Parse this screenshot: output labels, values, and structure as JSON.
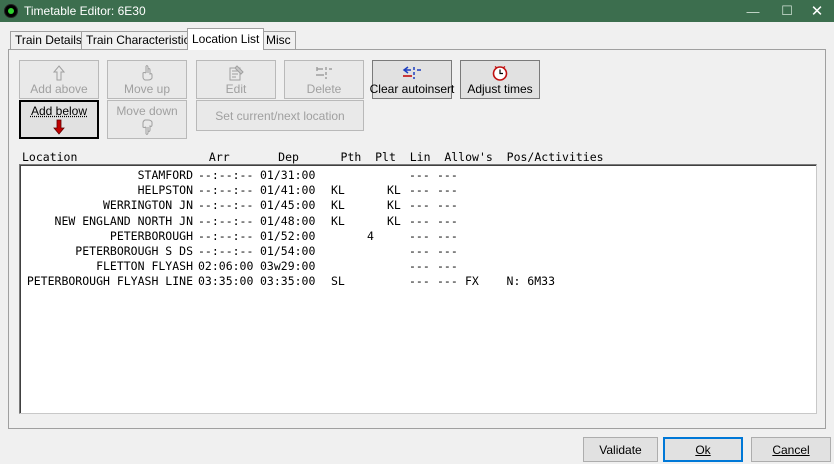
{
  "window": {
    "title": "Timetable Editor: 6E30",
    "icon": "green-dot-app-icon",
    "controls": {
      "minimize": "—",
      "maximize": "☐",
      "close": "✕"
    }
  },
  "tabs": [
    {
      "label": "Train Details",
      "active": false
    },
    {
      "label": "Train Characteristics",
      "active": false
    },
    {
      "label": "Location List",
      "active": true
    },
    {
      "label": "Misc",
      "active": false
    }
  ],
  "toolbar": {
    "add_above": {
      "label": "Add above",
      "enabled": false
    },
    "move_up": {
      "label": "Move up",
      "enabled": false
    },
    "edit": {
      "label": "Edit",
      "enabled": false
    },
    "delete": {
      "label": "Delete",
      "enabled": false
    },
    "clear_autoinsert": {
      "label": "Clear autoinsert",
      "enabled": true
    },
    "adjust_times": {
      "label": "Adjust times",
      "enabled": true
    },
    "add_below": {
      "label": "Add below",
      "enabled": true
    },
    "move_down": {
      "label": "Move down",
      "enabled": false
    },
    "set_current_next": {
      "label": "Set current/next location",
      "enabled": false
    }
  },
  "list": {
    "header": "Location                   Arr       Dep      Pth  Plt  Lin  Allow's  Pos/Activities",
    "rows": [
      {
        "location": "STAMFORD",
        "arr": "--:--:--",
        "dep": "01/31:00",
        "pth": "",
        "plt": "",
        "lin": "",
        "allow1": "---",
        "allow2": "---",
        "pos": ""
      },
      {
        "location": "HELPSTON",
        "arr": "--:--:--",
        "dep": "01/41:00",
        "pth": "KL",
        "plt": "",
        "lin": "KL",
        "allow1": "---",
        "allow2": "---",
        "pos": ""
      },
      {
        "location": "WERRINGTON JN",
        "arr": "--:--:--",
        "dep": "01/45:00",
        "pth": "KL",
        "plt": "",
        "lin": "KL",
        "allow1": "---",
        "allow2": "---",
        "pos": ""
      },
      {
        "location": "NEW ENGLAND NORTH JN",
        "arr": "--:--:--",
        "dep": "01/48:00",
        "pth": "KL",
        "plt": "",
        "lin": "KL",
        "allow1": "---",
        "allow2": "---",
        "pos": ""
      },
      {
        "location": "PETERBOROUGH",
        "arr": "--:--:--",
        "dep": "01/52:00",
        "pth": "",
        "plt": "4",
        "lin": "",
        "allow1": "---",
        "allow2": "---",
        "pos": ""
      },
      {
        "location": "PETERBOROUGH S DS",
        "arr": "--:--:--",
        "dep": "01/54:00",
        "pth": "",
        "plt": "",
        "lin": "",
        "allow1": "---",
        "allow2": "---",
        "pos": ""
      },
      {
        "location": "FLETTON FLYASH",
        "arr": "02:06:00",
        "dep": "03w29:00",
        "pth": "",
        "plt": "",
        "lin": "",
        "allow1": "---",
        "allow2": "---",
        "pos": ""
      },
      {
        "location": "PETERBOROUGH FLYASH LINE",
        "arr": "03:35:00",
        "dep": "03:35:00",
        "pth": "SL",
        "plt": "",
        "lin": "",
        "allow1": "---",
        "allow2": "---",
        "pos": "FX    N: 6M33"
      }
    ]
  },
  "footer": {
    "validate": "Validate",
    "ok": "Ok",
    "cancel": "Cancel"
  },
  "colors": {
    "titlebar": "#3c6e4e",
    "arrow_red": "#c00000",
    "clear_blue": "#1f3fbf",
    "clock_red": "#c01010"
  }
}
